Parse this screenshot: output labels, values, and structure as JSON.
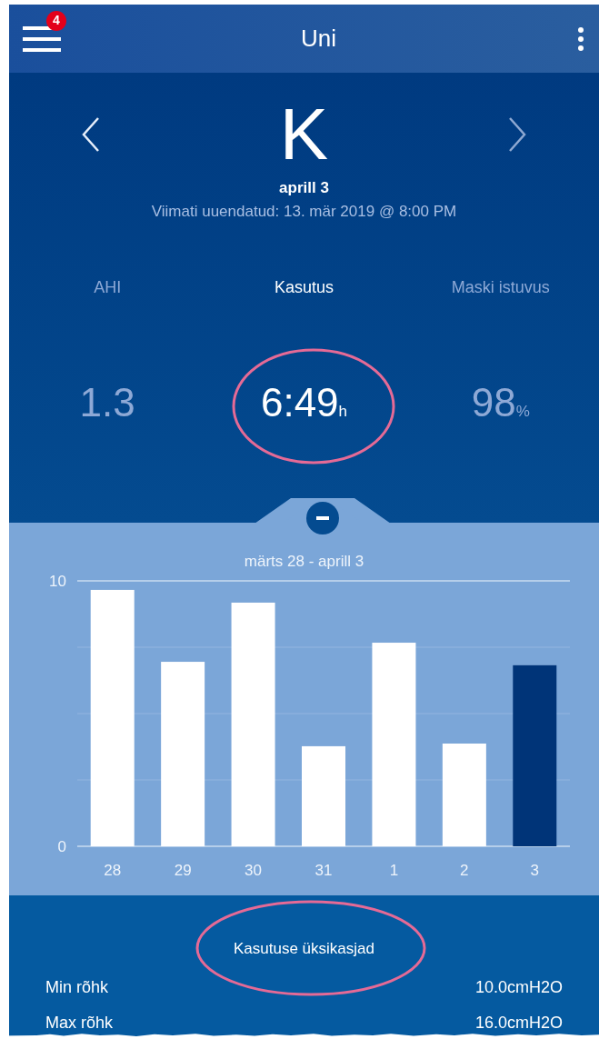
{
  "app_bar": {
    "badge": "4",
    "title": "Uni"
  },
  "day": {
    "letter": "K",
    "date": "aprill 3",
    "updated": "Viimati uuendatud: 13. mär 2019 @ 8:00 PM"
  },
  "metrics": [
    {
      "label": "AHI",
      "value": "1.3",
      "selected": false
    },
    {
      "label": "Kasutus",
      "value": "6:49",
      "unit": "h",
      "selected": true
    },
    {
      "label": "Maski istuvus",
      "value": "98",
      "unit": "%",
      "selected": false
    }
  ],
  "chart_panel": {
    "range": "märts 28 - aprill 3",
    "chart_data": {
      "type": "bar",
      "categories": [
        "28",
        "29",
        "30",
        "31",
        "1",
        "2",
        "3"
      ],
      "series": [
        {
          "color": "#ffffff",
          "values": [
            9.66,
            6.95,
            9.18,
            3.77,
            7.67,
            3.87,
            null
          ]
        },
        {
          "color": "#003478",
          "values": [
            null,
            null,
            null,
            null,
            null,
            null,
            6.82
          ]
        }
      ],
      "stacked": true,
      "ylim": [
        0,
        10
      ],
      "yticks": [
        0,
        10
      ]
    }
  },
  "details": {
    "title": "Kasutuse üksikasjad",
    "rows": [
      {
        "label": "Min rõhk",
        "value": "10.0cmH2O"
      },
      {
        "label": "Max rõhk",
        "value": "16.0cmH2O"
      }
    ]
  }
}
